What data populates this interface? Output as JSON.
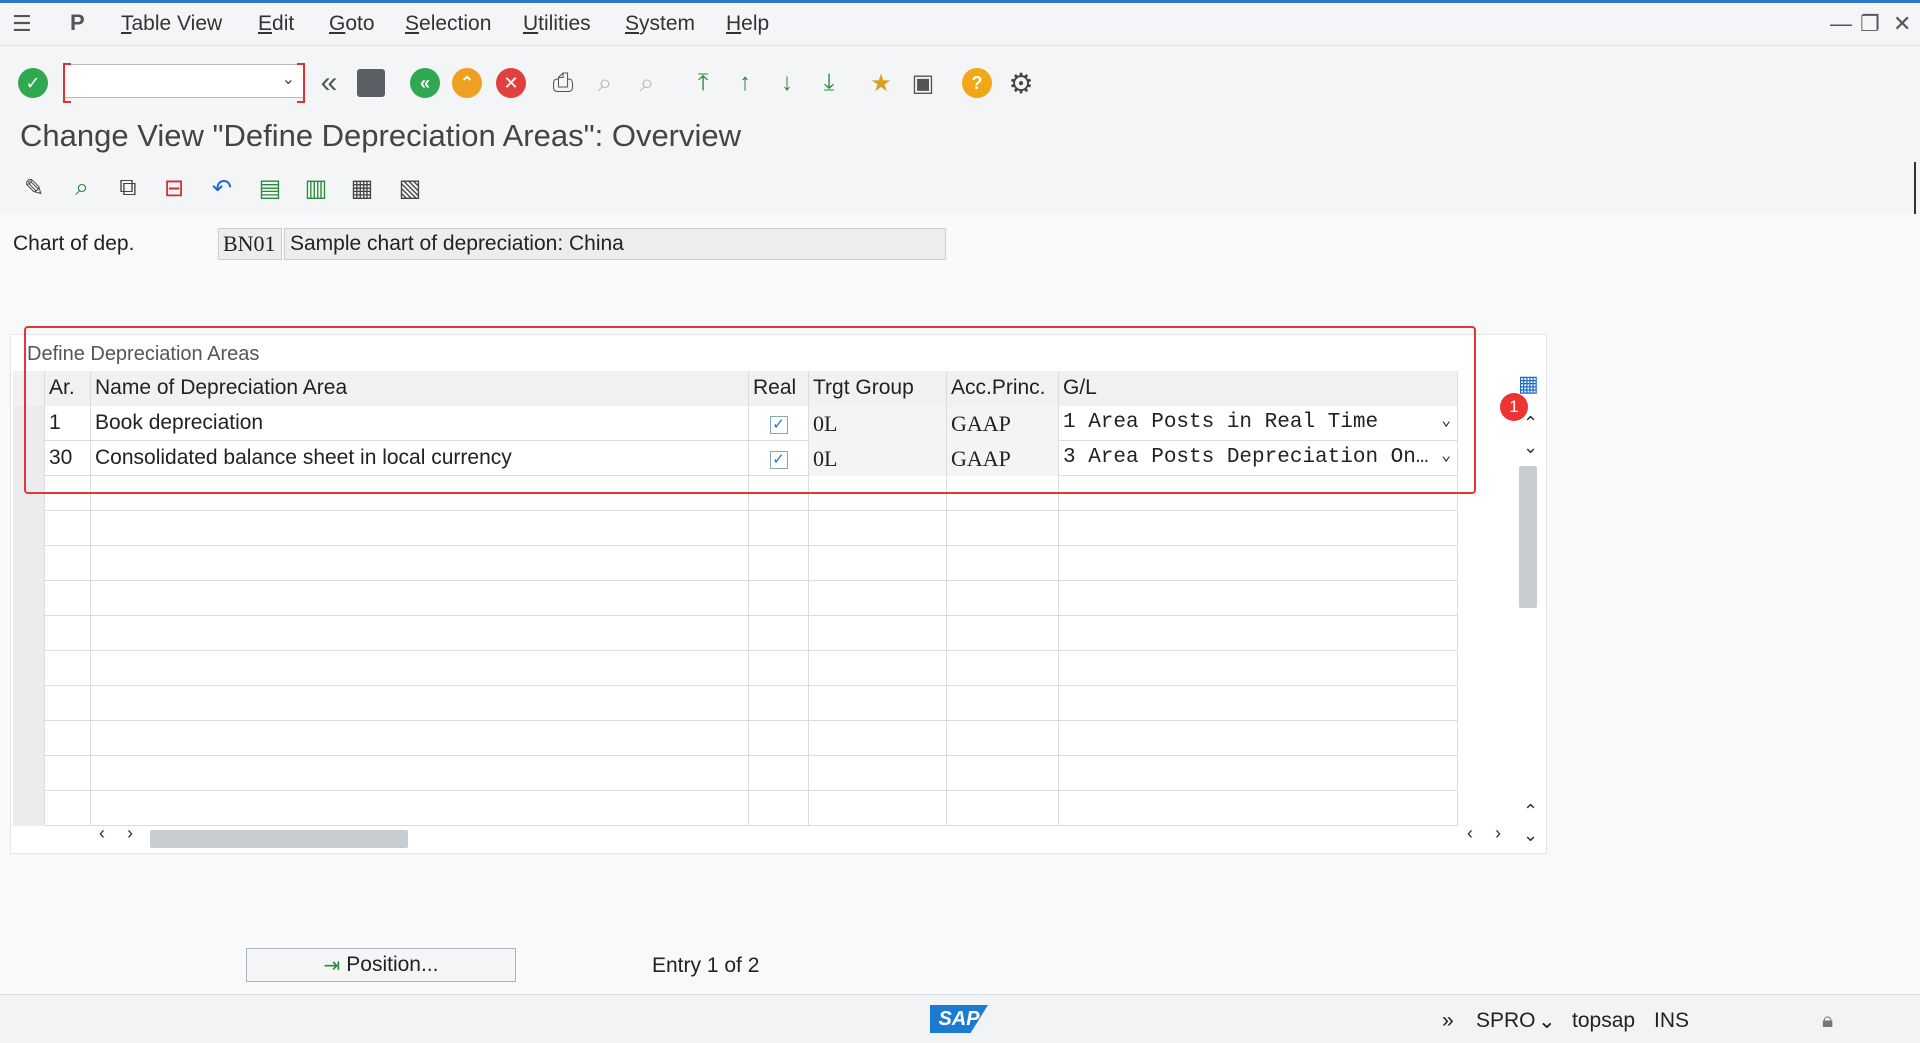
{
  "menu": {
    "items": [
      "Table View",
      "Edit",
      "Goto",
      "Selection",
      "Utilities",
      "System",
      "Help"
    ]
  },
  "toolbar": {
    "command_value": ""
  },
  "page": {
    "title": "Change View \"Define Depreciation Areas\": Overview"
  },
  "header_fields": {
    "chart_label": "Chart of dep.",
    "chart_value": "BN01",
    "chart_desc": "Sample chart of depreciation: China"
  },
  "table": {
    "caption": "Define Depreciation Areas",
    "columns": [
      "Ar.",
      "Name of Depreciation Area",
      "Real",
      "Trgt Group",
      "Acc.Princ.",
      "G/L"
    ],
    "rows": [
      {
        "area": "1",
        "name": "Book depreciation",
        "real": true,
        "target_group": "0L",
        "acc_princ": "GAAP",
        "gl": "1 Area Posts in Real Time"
      },
      {
        "area": "30",
        "name": "Consolidated balance sheet in local currency",
        "real": true,
        "target_group": "0L",
        "acc_princ": "GAAP",
        "gl": "3 Area Posts Depreciation On…"
      }
    ],
    "badge": "1"
  },
  "footer": {
    "position_button": "Position...",
    "entry_text": "Entry 1 of 2"
  },
  "status": {
    "arrows": "»",
    "transaction": "SPRO",
    "server": "topsap",
    "mode": "INS",
    "logo": "SAP"
  },
  "colors": {
    "accent": "#2a78c8",
    "annotation_red": "#e53535",
    "check_blue": "#1874d0"
  }
}
